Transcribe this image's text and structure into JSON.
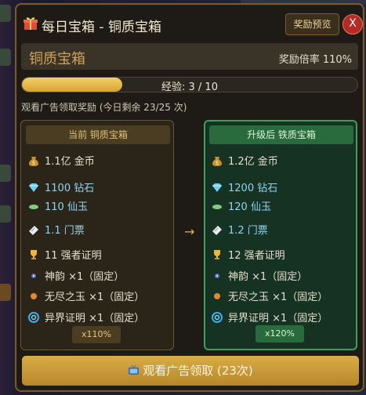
{
  "header": {
    "title": "每日宝箱 - 铜质宝箱",
    "preview_label": "奖励预览",
    "close_label": "X"
  },
  "chest": {
    "name": "铜质宝箱",
    "multiplier": "奖励倍率 110%"
  },
  "progress": {
    "text": "经验: 3 / 10",
    "value": 3,
    "max": 10
  },
  "ad_note": "观看广告领取奖励 (今日剩余 23/25 次)",
  "current": {
    "title": "当前 铜质宝箱",
    "rows": [
      "1.1亿 金币",
      "1100 钻石",
      "110 仙玉",
      "1.1 门票",
      "11 强者证明",
      "神韵 ×1（固定）",
      "无尽之玉 ×1（固定）",
      "异界证明 ×1（固定）"
    ],
    "footer": "x110%"
  },
  "upgraded": {
    "title": "升级后 铁质宝箱",
    "rows": [
      "1.2亿 金币",
      "1200 钻石",
      "120 仙玉",
      "1.2 门票",
      "12 强者证明",
      "神韵 ×1（固定）",
      "无尽之玉 ×1（固定）",
      "异界证明 ×1（固定）"
    ],
    "footer": "x120%"
  },
  "arrow": "→",
  "watch_button": "观看广告领取 (23次)",
  "icons": [
    "gift-icon",
    "coin-bag-icon",
    "diamond-icon",
    "jade-icon",
    "ticket-icon",
    "trophy-icon",
    "spirit-icon",
    "orb-icon",
    "portal-icon",
    "tv-icon"
  ]
}
